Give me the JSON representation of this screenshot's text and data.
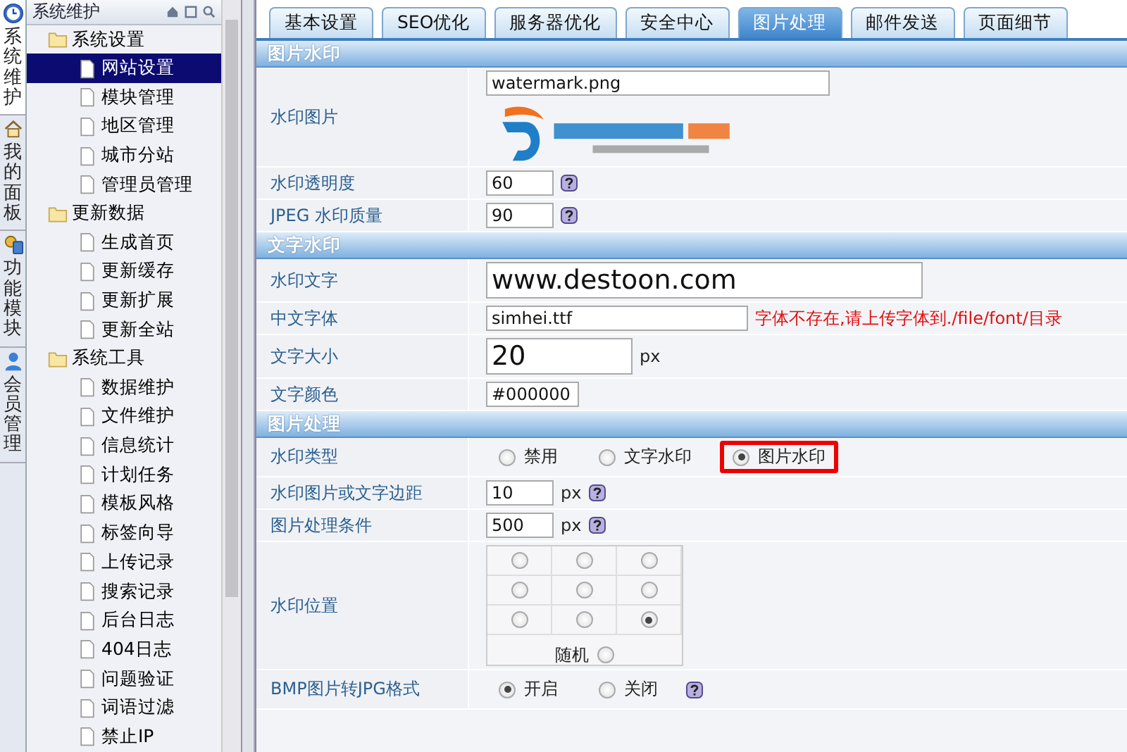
{
  "side_tabs": [
    {
      "label": "系统维护",
      "selected": true
    },
    {
      "label": "我的面板",
      "selected": false
    },
    {
      "label": "功能模块",
      "selected": false
    },
    {
      "label": "会员管理",
      "selected": false
    }
  ],
  "sidebar": {
    "title": "系统维护",
    "groups": [
      {
        "label": "系统设置",
        "children": [
          {
            "label": "网站设置",
            "selected": true
          },
          {
            "label": "模块管理",
            "selected": false
          },
          {
            "label": "地区管理",
            "selected": false
          },
          {
            "label": "城市分站",
            "selected": false
          },
          {
            "label": "管理员管理",
            "selected": false
          }
        ]
      },
      {
        "label": "更新数据",
        "children": [
          {
            "label": "生成首页",
            "selected": false
          },
          {
            "label": "更新缓存",
            "selected": false
          },
          {
            "label": "更新扩展",
            "selected": false
          },
          {
            "label": "更新全站",
            "selected": false
          }
        ]
      },
      {
        "label": "系统工具",
        "children": [
          {
            "label": "数据维护",
            "selected": false
          },
          {
            "label": "文件维护",
            "selected": false
          },
          {
            "label": "信息统计",
            "selected": false
          },
          {
            "label": "计划任务",
            "selected": false
          },
          {
            "label": "模板风格",
            "selected": false
          },
          {
            "label": "标签向导",
            "selected": false
          },
          {
            "label": "上传记录",
            "selected": false
          },
          {
            "label": "搜索记录",
            "selected": false
          },
          {
            "label": "后台日志",
            "selected": false
          },
          {
            "label": "404日志",
            "selected": false
          },
          {
            "label": "问题验证",
            "selected": false
          },
          {
            "label": "词语过滤",
            "selected": false
          },
          {
            "label": "禁止IP",
            "selected": false
          }
        ]
      }
    ]
  },
  "tabs": [
    {
      "label": "基本设置",
      "selected": false
    },
    {
      "label": "SEO优化",
      "selected": false
    },
    {
      "label": "服务器优化",
      "selected": false
    },
    {
      "label": "安全中心",
      "selected": false
    },
    {
      "label": "图片处理",
      "selected": true
    },
    {
      "label": "邮件发送",
      "selected": false
    },
    {
      "label": "页面细节",
      "selected": false
    }
  ],
  "sections": [
    {
      "title": "图片水印",
      "rows": [
        {
          "kind": "file",
          "label": "水印图片",
          "value": "watermark.png"
        },
        {
          "kind": "number",
          "label": "水印透明度",
          "value": "60",
          "help": true
        },
        {
          "kind": "number",
          "label": "JPEG 水印质量",
          "value": "90",
          "help": true
        }
      ]
    },
    {
      "title": "文字水印",
      "rows": [
        {
          "kind": "headline",
          "label": "水印文字",
          "value": "www.destoon.com"
        },
        {
          "kind": "font",
          "label": "中文字体",
          "value": "simhei.ttf",
          "error": "字体不存在,请上传字体到./file/font/目录"
        },
        {
          "kind": "size",
          "label": "文字大小",
          "value": "20",
          "unit": "px"
        },
        {
          "kind": "color",
          "label": "文字颜色",
          "value": "#000000"
        }
      ]
    },
    {
      "title": "图片处理",
      "rows": [
        {
          "kind": "radio",
          "label": "水印类型",
          "options": [
            {
              "label": "禁用",
              "selected": false,
              "highlighted": false
            },
            {
              "label": "文字水印",
              "selected": false,
              "highlighted": false
            },
            {
              "label": "图片水印",
              "selected": true,
              "highlighted": true
            }
          ]
        },
        {
          "kind": "number",
          "label": "水印图片或文字边距",
          "value": "10",
          "unit": "px",
          "help": true
        },
        {
          "kind": "number",
          "label": "图片处理条件",
          "value": "500",
          "unit": "px",
          "help": true
        },
        {
          "kind": "position",
          "label": "水印位置",
          "positions": [
            {
              "selected": false
            },
            {
              "selected": false
            },
            {
              "selected": false
            },
            {
              "selected": false
            },
            {
              "selected": false
            },
            {
              "selected": false
            },
            {
              "selected": false
            },
            {
              "selected": false
            },
            {
              "selected": true
            }
          ],
          "random": {
            "label": "随机",
            "selected": false
          }
        },
        {
          "kind": "radio",
          "label": "BMP图片转JPG格式",
          "help": true,
          "options": [
            {
              "label": "开启",
              "selected": true,
              "highlighted": false
            },
            {
              "label": "关闭",
              "selected": false,
              "highlighted": false
            }
          ]
        }
      ]
    }
  ]
}
